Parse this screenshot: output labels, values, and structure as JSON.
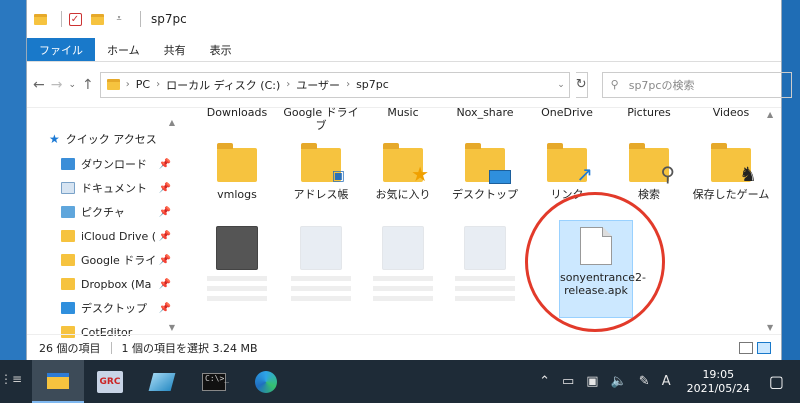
{
  "titlebar": {
    "title": "sp7pc"
  },
  "ribbon": {
    "tabs": [
      {
        "label": "ファイル"
      },
      {
        "label": "ホーム"
      },
      {
        "label": "共有"
      },
      {
        "label": "表示"
      }
    ]
  },
  "address": {
    "crumbs": [
      "PC",
      "ローカル ディスク (C:)",
      "ユーザー",
      "sp7pc"
    ],
    "search_placeholder": "sp7pcの検索"
  },
  "nav": {
    "header": "クイック アクセス",
    "items": [
      {
        "label": "ダウンロード"
      },
      {
        "label": "ドキュメント"
      },
      {
        "label": "ピクチャ"
      },
      {
        "label": "iCloud Drive ("
      },
      {
        "label": "Google ドライ"
      },
      {
        "label": "Dropbox (Ma"
      },
      {
        "label": "デスクトップ"
      },
      {
        "label": "CotEditor"
      }
    ]
  },
  "content": {
    "top_labels": [
      "Downloads",
      "Google ドライブ",
      "Music",
      "Nox_share",
      "OneDrive",
      "Pictures",
      "Videos"
    ],
    "folders": [
      {
        "label": "vmlogs"
      },
      {
        "label": "アドレス帳"
      },
      {
        "label": "お気に入り"
      },
      {
        "label": "デスクトップ"
      },
      {
        "label": "リンク"
      },
      {
        "label": "検索"
      },
      {
        "label": "保存したゲーム"
      }
    ],
    "selected_file": {
      "label": "sonyentrance2-release.apk"
    }
  },
  "status": {
    "count": "26 個の項目",
    "selection": "1 個の項目を選択  3.24 MB"
  },
  "taskbar": {
    "grc_label": "GRC",
    "cmd_label": "C:\\>_",
    "ime": "A",
    "time": "19:05",
    "date": "2021/05/24"
  }
}
